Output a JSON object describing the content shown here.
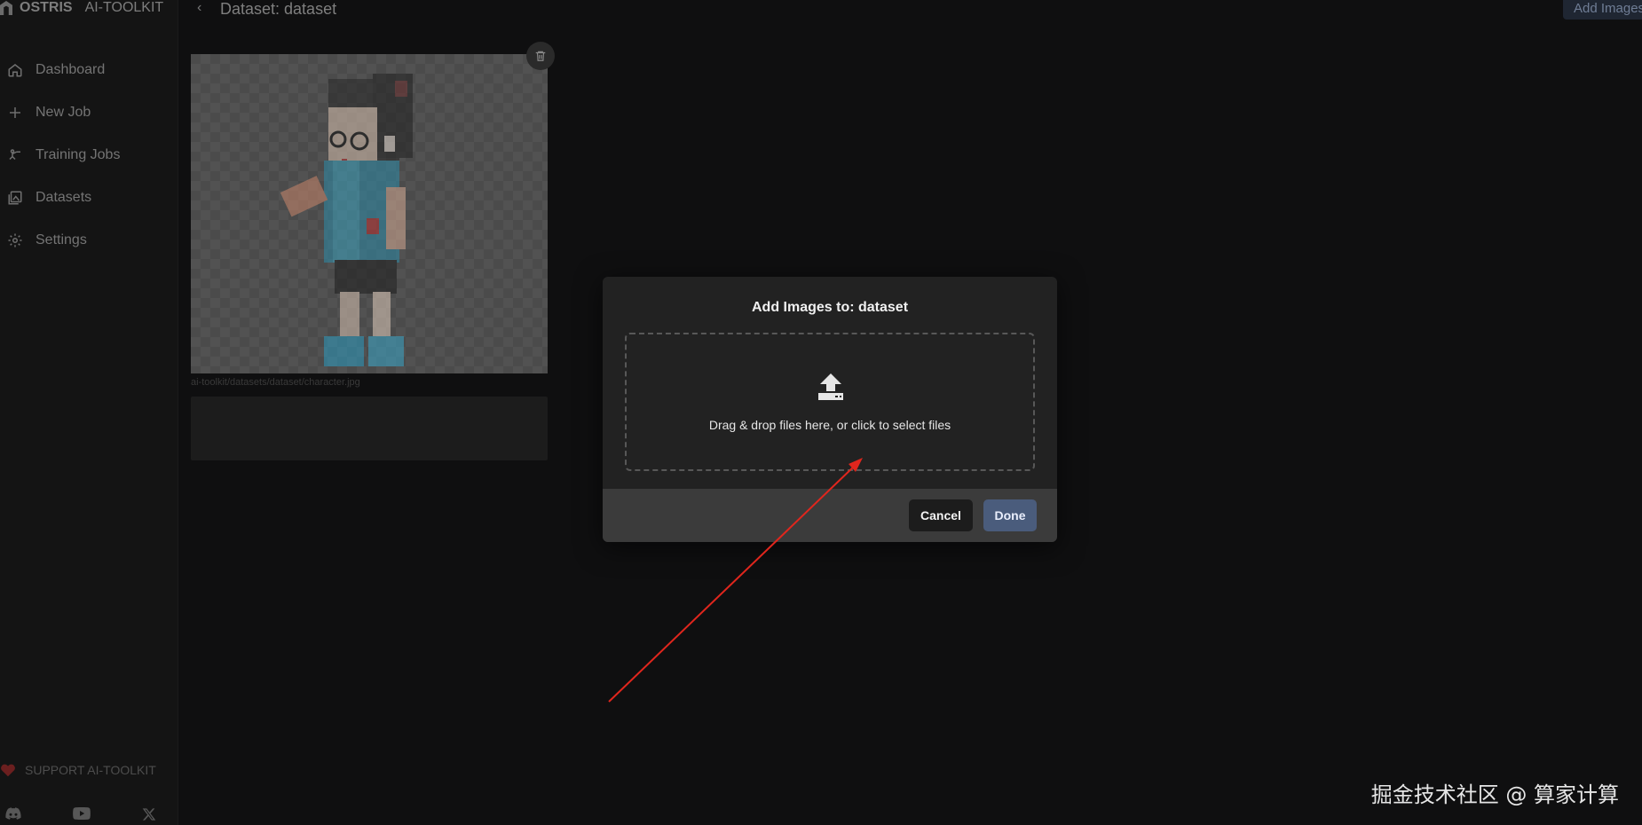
{
  "app": {
    "brand": "OSTRIS",
    "brand_suffix": "AI-TOOLKIT"
  },
  "sidebar": {
    "items": [
      {
        "label": "Dashboard",
        "icon": "home-icon"
      },
      {
        "label": "New Job",
        "icon": "plus-icon"
      },
      {
        "label": "Training Jobs",
        "icon": "training-icon"
      },
      {
        "label": "Datasets",
        "icon": "images-icon"
      },
      {
        "label": "Settings",
        "icon": "gear-icon"
      }
    ],
    "support": "SUPPORT AI-TOOLKIT",
    "socials": [
      "discord-icon",
      "youtube-icon",
      "x-icon"
    ]
  },
  "header": {
    "title": "Dataset: dataset",
    "add_images": "Add Images"
  },
  "card": {
    "file_path": "ai-toolkit/datasets/dataset/character.jpg",
    "caption": ""
  },
  "modal": {
    "title": "Add Images to: dataset",
    "drop_text": "Drag & drop files here, or click to select files",
    "cancel": "Cancel",
    "done": "Done"
  },
  "watermark": "掘金技术社区 @ 算家计算",
  "colors": {
    "accent": "#4a5c7c",
    "arrow": "#e0261d"
  }
}
